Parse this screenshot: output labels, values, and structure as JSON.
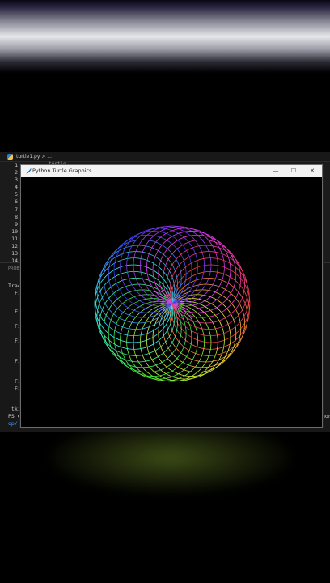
{
  "editor": {
    "tab_label": "turtle1.py > ...",
    "line_numbers": [
      "1",
      "2",
      "3",
      "4",
      "5",
      "6",
      "7",
      "8",
      "9",
      "10",
      "11",
      "12",
      "13",
      "14"
    ],
    "code_peek": "turtle",
    "panel_tab": "PROB"
  },
  "terminal": {
    "lines": [
      "Trac",
      "Fi",
      "Fi",
      "Fi",
      "Fi",
      "Fi",
      "Fi",
      "Fi",
      "tki",
      "PS C",
      "op/"
    ],
    "right_fragment": "hon"
  },
  "turtle_window": {
    "title": "Python Turtle Graphics",
    "minimize": "—",
    "maximize": "☐",
    "close": "✕",
    "icon": "feather-icon"
  },
  "drawing": {
    "pattern": "spirograph",
    "circle_count": 36,
    "background": "#000000"
  },
  "colors": {
    "title_bar": "#f3f3f3",
    "editor_bg": "#1b1b1b",
    "terminal_link": "#3aa0ff"
  }
}
